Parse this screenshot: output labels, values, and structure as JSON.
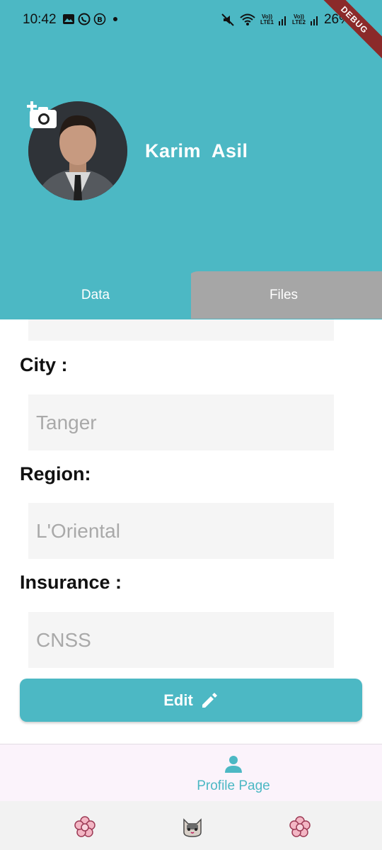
{
  "status_bar": {
    "time": "10:42",
    "battery": "26%",
    "sim1": "Vo))\nLTE1",
    "sim2": "Vo))\nLTE2",
    "left_icons": [
      "gallery-icon",
      "whatsapp-icon",
      "b-badge-icon",
      "dot-icon"
    ],
    "right_icons": [
      "mute-icon",
      "wifi-icon",
      "signal-icon",
      "signal-icon"
    ]
  },
  "debug_banner": "DEBUG",
  "profile": {
    "name": "Karim  Asil",
    "add_photo_icon": "add-photo-icon"
  },
  "tabs": {
    "data_label": "Data",
    "files_label": "Files"
  },
  "fields": {
    "city": {
      "label": "City :",
      "value": "Tanger"
    },
    "region": {
      "label": "Region:",
      "value": "L'Oriental"
    },
    "insurance": {
      "label": "Insurance :",
      "value": "CNSS"
    }
  },
  "edit_button": {
    "label": "Edit",
    "icon": "pencil-icon"
  },
  "bottom_nav": {
    "profile_label": "Profile Page",
    "profile_icon": "person-icon"
  },
  "system_bar_icons": [
    "flower-icon",
    "cat-icon",
    "flower-icon"
  ],
  "colors": {
    "primary": "#4cb8c4",
    "tab_inactive": "#a6a6a6",
    "field_bg": "#f5f5f5",
    "placeholder_text": "#a9a9a9",
    "debug_ribbon": "#8b2a2a"
  }
}
